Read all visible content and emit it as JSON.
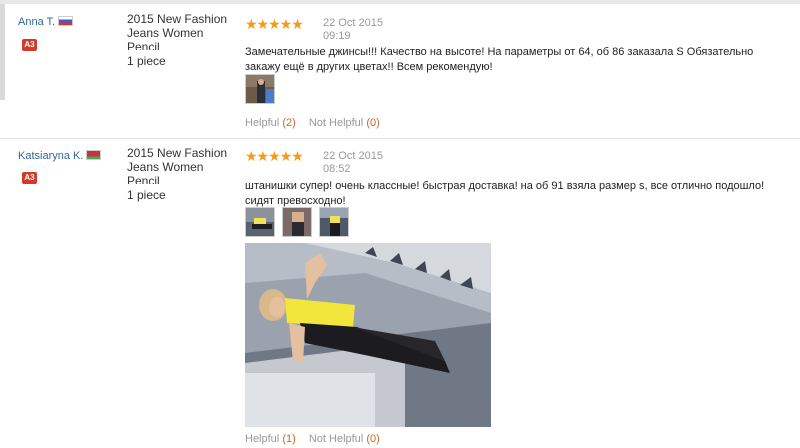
{
  "reviews": [
    {
      "user": "Anna T.",
      "badge": "A3",
      "product": "2015 New Fashion Jeans Women Pencil",
      "quantity": "1 piece",
      "stars": "★★★★★",
      "date": "22 Oct 2015",
      "time": "09:19",
      "text": "Замечательные джинсы!!! Качество на высоте! На параметры от 64, об 86 заказала S Обязательно закажу ещё в других цветах!! Всем рекомендую!",
      "helpful_label": "Helpful",
      "helpful_count": "(2)",
      "not_helpful_label": "Not Helpful",
      "not_helpful_count": "(0)"
    },
    {
      "user": "Katsiaryna K.",
      "badge": "A3",
      "product": "2015 New Fashion Jeans Women Pencil",
      "quantity": "1 piece",
      "stars": "★★★★★",
      "date": "22 Oct 2015",
      "time": "08:52",
      "text": "штанишки супер! очень классные! быстрая доставка! на об 91 взяла размер s, все отлично подошло! сидят превосходно!",
      "helpful_label": "Helpful",
      "helpful_count": "(1)",
      "not_helpful_label": "Not Helpful",
      "not_helpful_count": "(0)"
    }
  ],
  "icons": {
    "flag_1": "russia-flag-icon",
    "flag_2": "belarus-flag-icon",
    "star": "star-icon"
  },
  "colors": {
    "username": "#336699",
    "stars": "#f59a1a",
    "badge": "#d43a2a",
    "count": "#c9682a"
  }
}
